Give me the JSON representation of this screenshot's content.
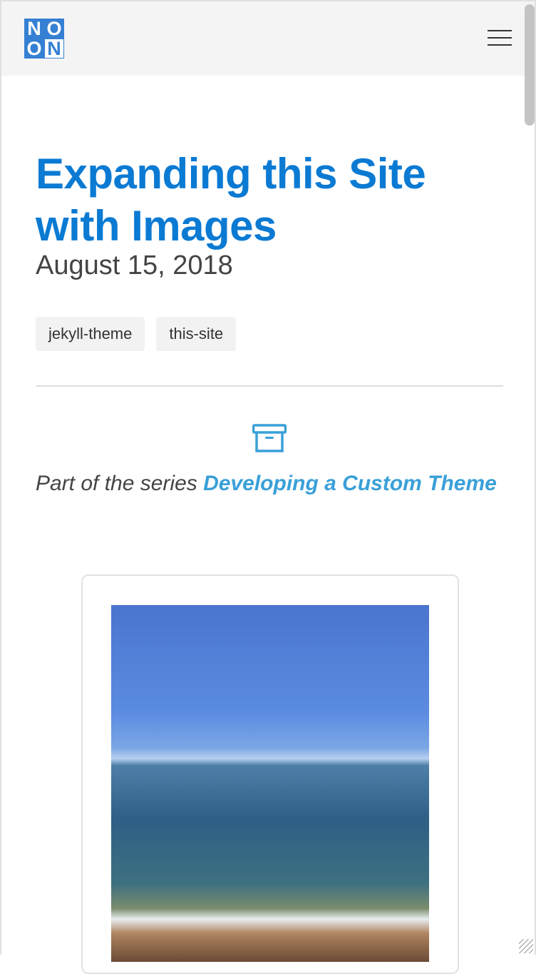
{
  "header": {
    "logo": [
      "N",
      "O",
      "O",
      "N"
    ],
    "menu_icon": "hamburger-icon"
  },
  "post": {
    "title": "Expanding this Site with Images",
    "date": "August 15, 2018",
    "tags": [
      "jekyll-theme",
      "this-site"
    ],
    "series_prefix": "Part of the series ",
    "series_link": "Developing a Custom Theme"
  },
  "colors": {
    "accent": "#0b7ad3",
    "link": "#3aa0d8",
    "logo": "#3580d3"
  }
}
